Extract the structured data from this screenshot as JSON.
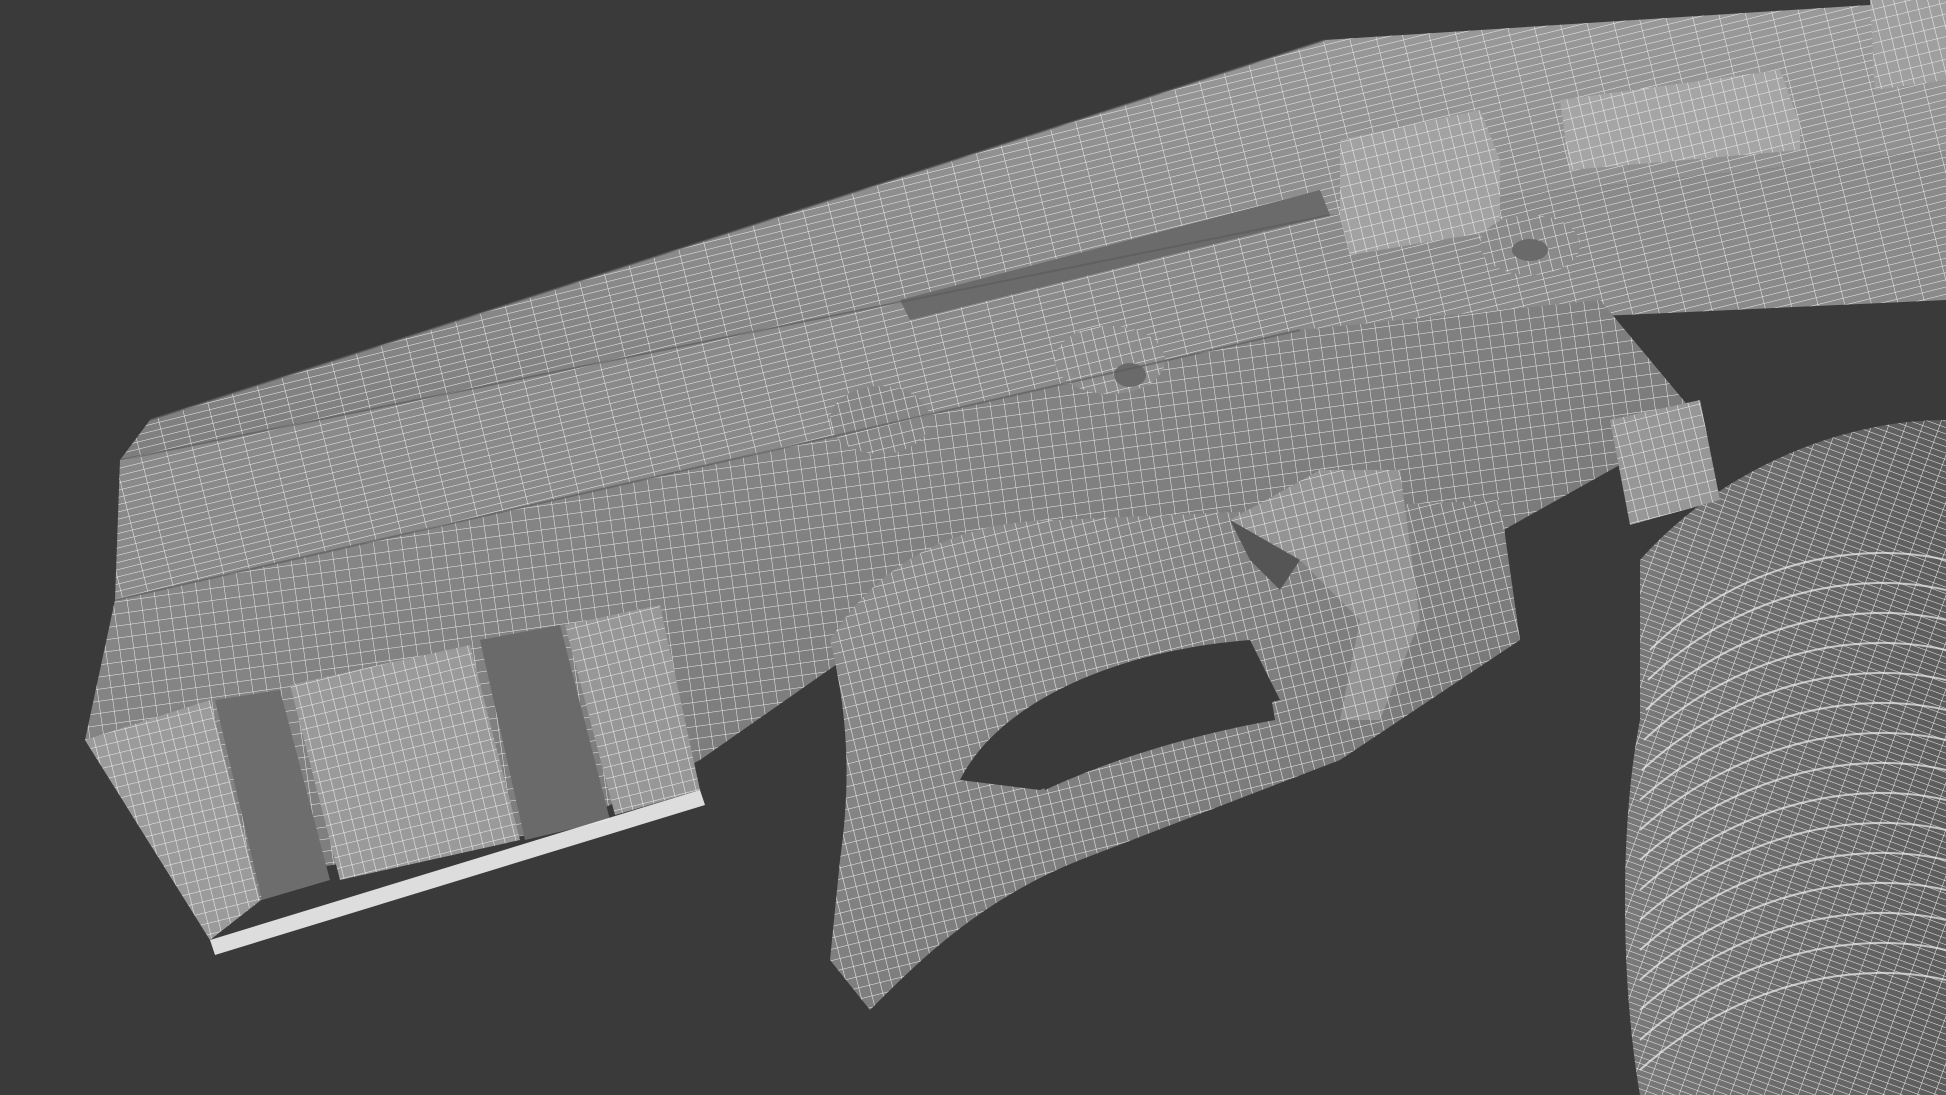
{
  "scene": {
    "subject": "pistol-wireframe-model",
    "background_color": "#3a3a3a",
    "surface_color": "#8c8c8c",
    "wire_color": "#e6e6e6"
  }
}
